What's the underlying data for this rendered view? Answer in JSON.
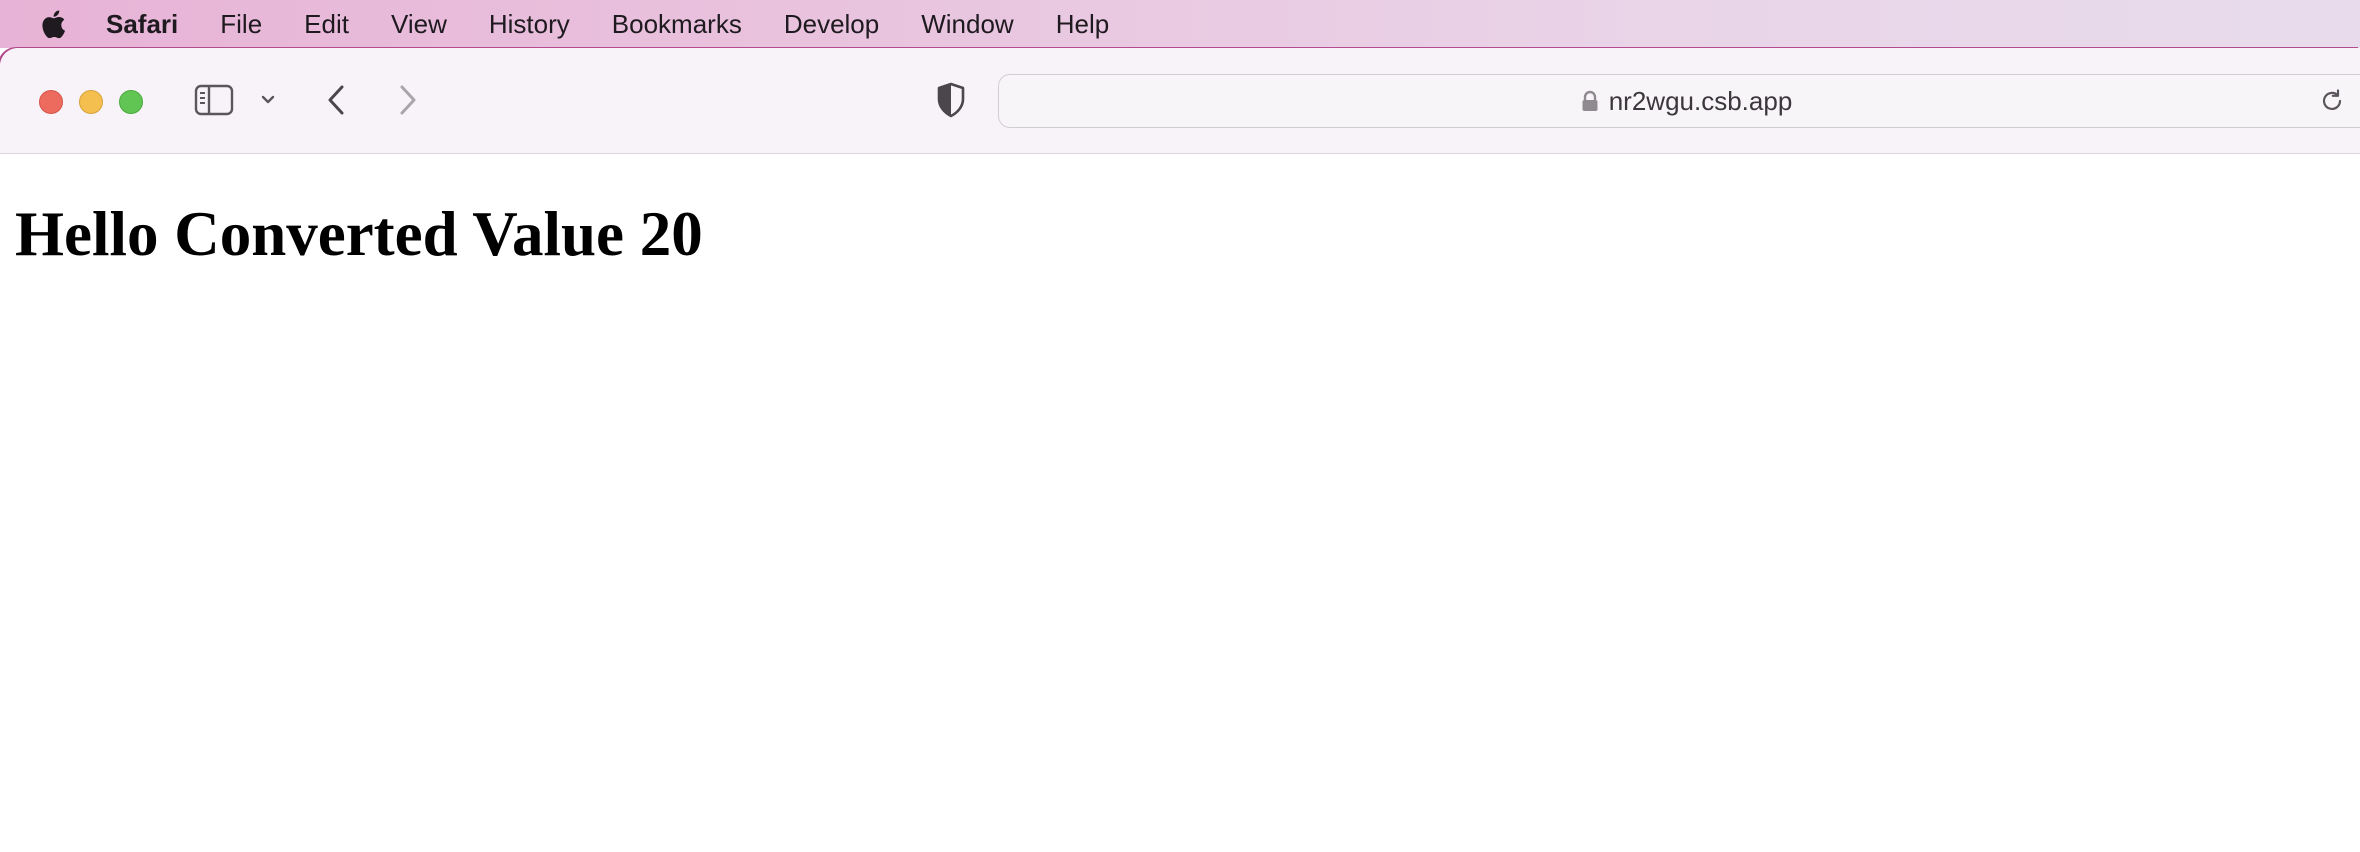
{
  "menubar": {
    "apple_icon": "apple-logo-icon",
    "app_name": "Safari",
    "items": [
      "File",
      "Edit",
      "View",
      "History",
      "Bookmarks",
      "Develop",
      "Window",
      "Help"
    ]
  },
  "toolbar": {
    "window_controls": [
      "close",
      "minimize",
      "maximize"
    ],
    "sidebar_icon": "sidebar-icon",
    "tab_group_icon": "chevron-down-icon",
    "back_icon": "chevron-left-icon",
    "forward_icon": "chevron-right-icon",
    "privacy_icon": "shield-icon",
    "address": {
      "url": "nr2wgu.csb.app",
      "secure_icon": "lock-icon",
      "reload_icon": "reload-icon"
    }
  },
  "page": {
    "heading": "Hello Converted Value 20"
  },
  "colors": {
    "close": "#ed6a5e",
    "minimize": "#f4bf4f",
    "maximize": "#61c554"
  }
}
